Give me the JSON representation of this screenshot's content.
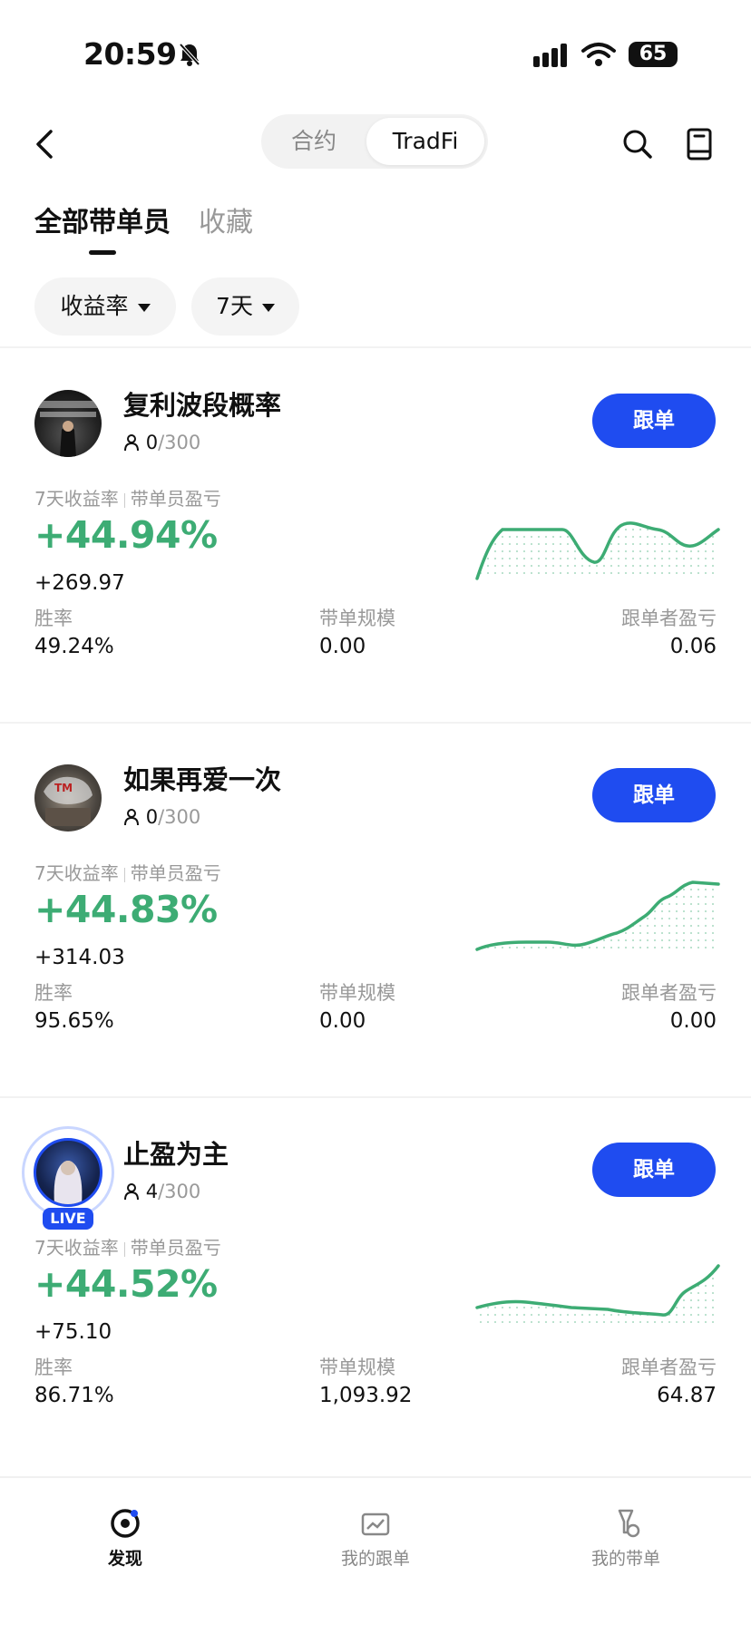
{
  "status_bar": {
    "time": "20:59",
    "battery": "65"
  },
  "header": {
    "segments": [
      "合约",
      "TradFi"
    ],
    "active_segment": "TradFi"
  },
  "tabs": {
    "active": "全部带单员",
    "inactive": "收藏"
  },
  "filters": {
    "sort": "收益率",
    "period": "7天"
  },
  "card_labels": {
    "metric_left": "7天收益率",
    "metric_right": "带单员盈亏",
    "win_rate": "胜率",
    "scale": "带单规模",
    "follower_pnl": "跟单者盈亏",
    "follow_button": "跟单",
    "live": "LIVE"
  },
  "traders": [
    {
      "name": "复利波段概率",
      "followers": "0",
      "max": "/300",
      "roi": "+44.94%",
      "pnl": "+269.97",
      "win_rate": "49.24%",
      "scale": "0.00",
      "follower_pnl": "0.06",
      "live": false,
      "line_color": "#3dac74"
    },
    {
      "name": "如果再爱一次",
      "followers": "0",
      "max": "/300",
      "roi": "+44.83%",
      "pnl": "+314.03",
      "win_rate": "95.65%",
      "scale": "0.00",
      "follower_pnl": "0.00",
      "live": false,
      "line_color": "#3dac74"
    },
    {
      "name": "止盈为主",
      "followers": "4",
      "max": "/300",
      "roi": "+44.52%",
      "pnl": "+75.10",
      "win_rate": "86.71%",
      "scale": "1,093.92",
      "follower_pnl": "64.87",
      "live": true,
      "line_color": "#3dac74"
    }
  ],
  "bottom_nav": {
    "discover": "发现",
    "my_copy": "我的跟单",
    "my_lead": "我的带单"
  },
  "icons": [
    "bell-off-icon",
    "signal-icon",
    "wifi-icon",
    "back-icon",
    "search-icon",
    "book-icon",
    "user-icon",
    "discover-icon",
    "chart-icon",
    "flask-icon"
  ],
  "colors": {
    "accent": "#1f4cf0",
    "profit": "#3dac74"
  }
}
